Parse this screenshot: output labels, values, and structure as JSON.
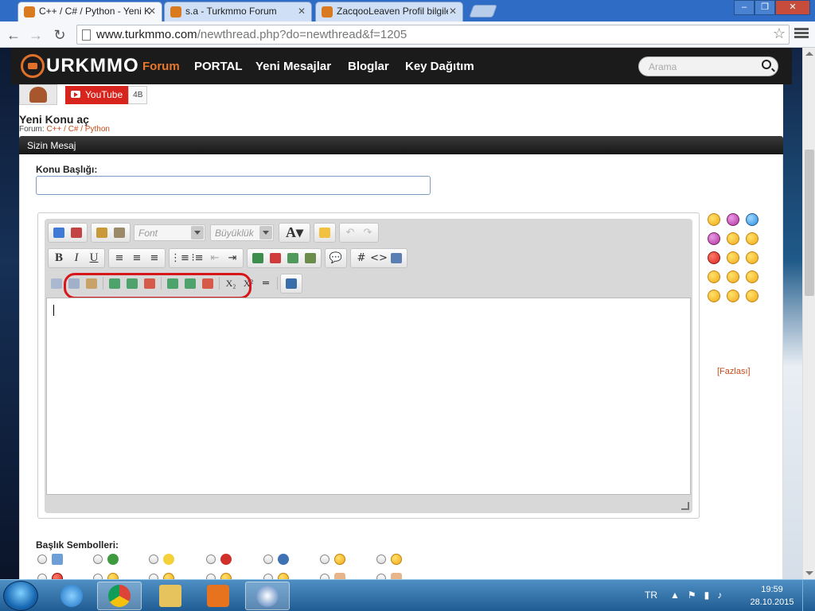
{
  "browser": {
    "tabs": [
      {
        "title": "C++ / C# / Python - Yeni K",
        "active": true
      },
      {
        "title": "s.a - Turkmmo Forum",
        "active": false
      },
      {
        "title": "ZacqooLeaven Profil bilgile",
        "active": false
      }
    ],
    "url_host": "www.turkmmo.com",
    "url_path": "/newthread.php?do=newthread&f=1205"
  },
  "site": {
    "logo_text": "URKMMO",
    "nav": [
      "Forum",
      "PORTAL",
      "Yeni Mesajlar",
      "Bloglar",
      "Key Dağıtım"
    ],
    "search_placeholder": "Arama"
  },
  "youtube": {
    "label": "YouTube",
    "count": "4B"
  },
  "page": {
    "title": "Yeni Konu aç",
    "breadcrumb_prefix": "Forum:",
    "breadcrumb_link": "C++ / C# / Python",
    "panel_title": "Sizin Mesaj",
    "subject_label": "Konu Başlığı:",
    "subject_value": ""
  },
  "editor": {
    "font_placeholder": "Font",
    "size_placeholder": "Büyüklük",
    "font_color_label": "A",
    "bold": "B",
    "italic": "I",
    "underline": "U",
    "hash": "#",
    "code": "<>",
    "sub": "X₂",
    "sup": "X²"
  },
  "smilies": {
    "more_label": "[Fazlası]"
  },
  "symbols": {
    "label": "Başlık Sembolleri:"
  },
  "taskbar": {
    "language": "TR",
    "time": "19:59",
    "date": "28.10.2015"
  },
  "colors": {
    "accent": "#e9782f",
    "header": "#1b1b1b",
    "highlight": "#d7161b",
    "link": "#c84c1a"
  }
}
